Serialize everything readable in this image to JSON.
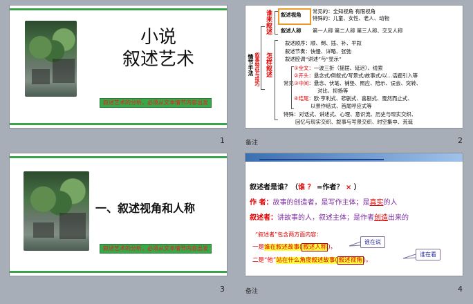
{
  "slides": [
    {
      "number": "1",
      "title_line1": "小说",
      "title_line2": "叙述艺术",
      "banner": "叙述艺术的分析，必须从文本情节内容出发"
    },
    {
      "number": "2",
      "note": "备注",
      "vertical_left": "情节手法",
      "vertical_who": "谁来叙述",
      "vertical_how": "怎样叙述",
      "vertical_side": "叙事特征与技巧",
      "row_view_label": "叙述视角",
      "row_view_text1": "常见的：全知视角  有限视角",
      "row_view_text2": "特殊的：儿童、女性、老人、动物",
      "row_person_label": "叙述人称",
      "row_person_text": "第一人称  第二人称  第三人称、交叉人称",
      "order": "叙述顺序：顺、倒、插、补、平叙",
      "rhythm": "叙述节奏：快慢、详略、张弛",
      "way": "叙述腔调“讲述”与“显示”",
      "common": "常见",
      "item1_label": "①全文：",
      "item1_text": "一波三折（摇摆、延迟）、线索",
      "item2_label": "②开头：",
      "item2_text": "悬念式/倒叙式/写景式/故事式/以…话题引入等",
      "item3_label": "③中间：",
      "item3_text": "悬念、伏笔、铺垫、照应、陪示、误会、突转、",
      "item3_text2": "对比、抑扬等",
      "item4_label": "④结尾：",
      "item4_text": "欧·亨利式、悲剧式、喜剧式、戛然而止式、",
      "item4_text2": "以景作结式、首尾呼应式等",
      "special_label": "特殊：",
      "special_text": "对话式、讲述式、心理、意识流、历史与现实交织、",
      "special_text2": "回忆与现实交织、叙事与写景交织、时空集中、荒诞"
    },
    {
      "number": "3",
      "title": "一、叙述视角和人称",
      "banner": "叙述艺术的分析，必须从文本情节内容出发"
    },
    {
      "number": "4",
      "note": "备注",
      "q_prefix": "叙述者是谁？（",
      "q_who": "谁 ？",
      "q_eq": " =作者？",
      "q_x": " ×",
      "q_close": " ）",
      "author_label": "作    者：",
      "author_text1": "故事的创造者，是写作主体；是",
      "author_real": "真实",
      "author_text2": "的人",
      "narrator_label": "叙述者：",
      "narrator_text1": "讲故事的人，叙述主体；是作者",
      "narrator_create": "创造",
      "narrator_text2": "出来的",
      "contains": "“叙述者”包含两方面内容：",
      "line1_a": "一是",
      "line1_b": "谁在叙述故事(",
      "line1_c": "叙述人称",
      "line1_d": ")，",
      "line2_a": "二是“他”",
      "line2_b": "站在什么角度叙述故事(",
      "line2_c": "叙述视角",
      "line2_d": ")。",
      "callout1": "谁在说",
      "callout2": "谁在看"
    }
  ],
  "colors": {
    "accent_red": "#e30000",
    "green_bar": "#3aa34a",
    "blue_text": "#1a3ea8",
    "purple_text": "#7b2aa0"
  }
}
